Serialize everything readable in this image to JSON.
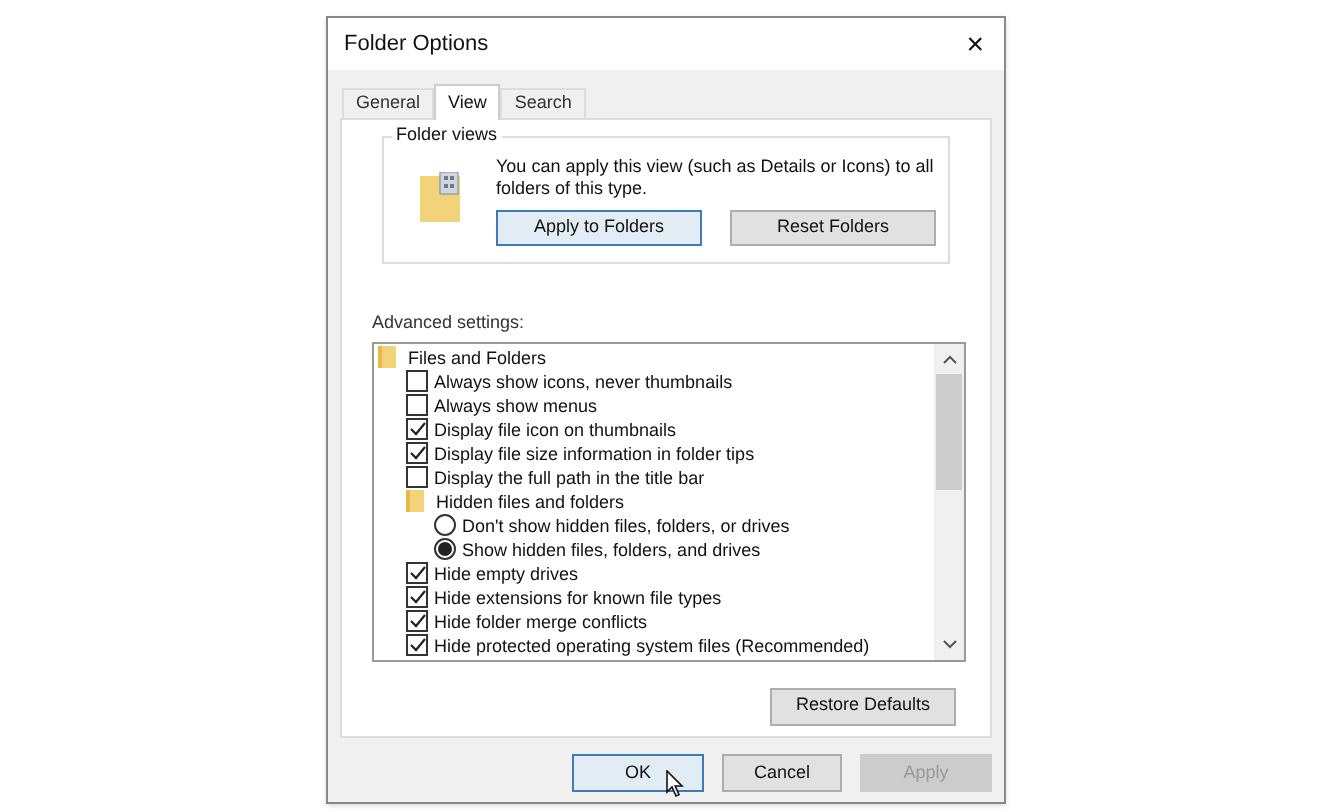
{
  "window": {
    "title": "Folder Options",
    "close": "×"
  },
  "tabs": [
    {
      "label": "General",
      "selected": false
    },
    {
      "label": "View",
      "selected": true
    },
    {
      "label": "Search",
      "selected": false
    }
  ],
  "folder_views": {
    "title": "Folder views",
    "description": "You can apply this view (such as Details or Icons) to all folders of this type.",
    "buttons": [
      {
        "label": "Apply to Folders",
        "focused": true
      },
      {
        "label": "Reset Folders",
        "focused": false
      }
    ]
  },
  "advanced_settings": {
    "label": "Advanced settings:",
    "items": [
      {
        "kind": "folder",
        "label": "Files and Folders",
        "children": [
          {
            "kind": "checkbox",
            "label": "Always show icons, never thumbnails",
            "checked": false
          },
          {
            "kind": "checkbox",
            "label": "Always show menus",
            "checked": false
          },
          {
            "kind": "checkbox",
            "label": "Display file icon on thumbnails",
            "checked": true
          },
          {
            "kind": "checkbox",
            "label": "Display file size information in folder tips",
            "checked": true
          },
          {
            "kind": "checkbox",
            "label": "Display the full path in the title bar",
            "checked": false
          },
          {
            "kind": "folder",
            "label": "Hidden files and folders",
            "children": [
              {
                "kind": "radio",
                "label": "Don't show hidden files, folders, or drives",
                "selected": false
              },
              {
                "kind": "radio",
                "label": "Show hidden files, folders, and drives",
                "selected": true
              }
            ]
          },
          {
            "kind": "checkbox",
            "label": "Hide empty drives",
            "checked": true
          },
          {
            "kind": "checkbox",
            "label": "Hide extensions for known file types",
            "checked": true
          },
          {
            "kind": "checkbox",
            "label": "Hide folder merge conflicts",
            "checked": true
          },
          {
            "kind": "checkbox",
            "label": "Hide protected operating system files (Recommended)",
            "checked": true
          }
        ]
      }
    ]
  },
  "restore_button": "Restore Defaults",
  "dialog_buttons": [
    {
      "label": "OK",
      "focused": true,
      "disabled": false
    },
    {
      "label": "Cancel",
      "focused": false,
      "disabled": false
    },
    {
      "label": "Apply",
      "focused": false,
      "disabled": true
    }
  ]
}
